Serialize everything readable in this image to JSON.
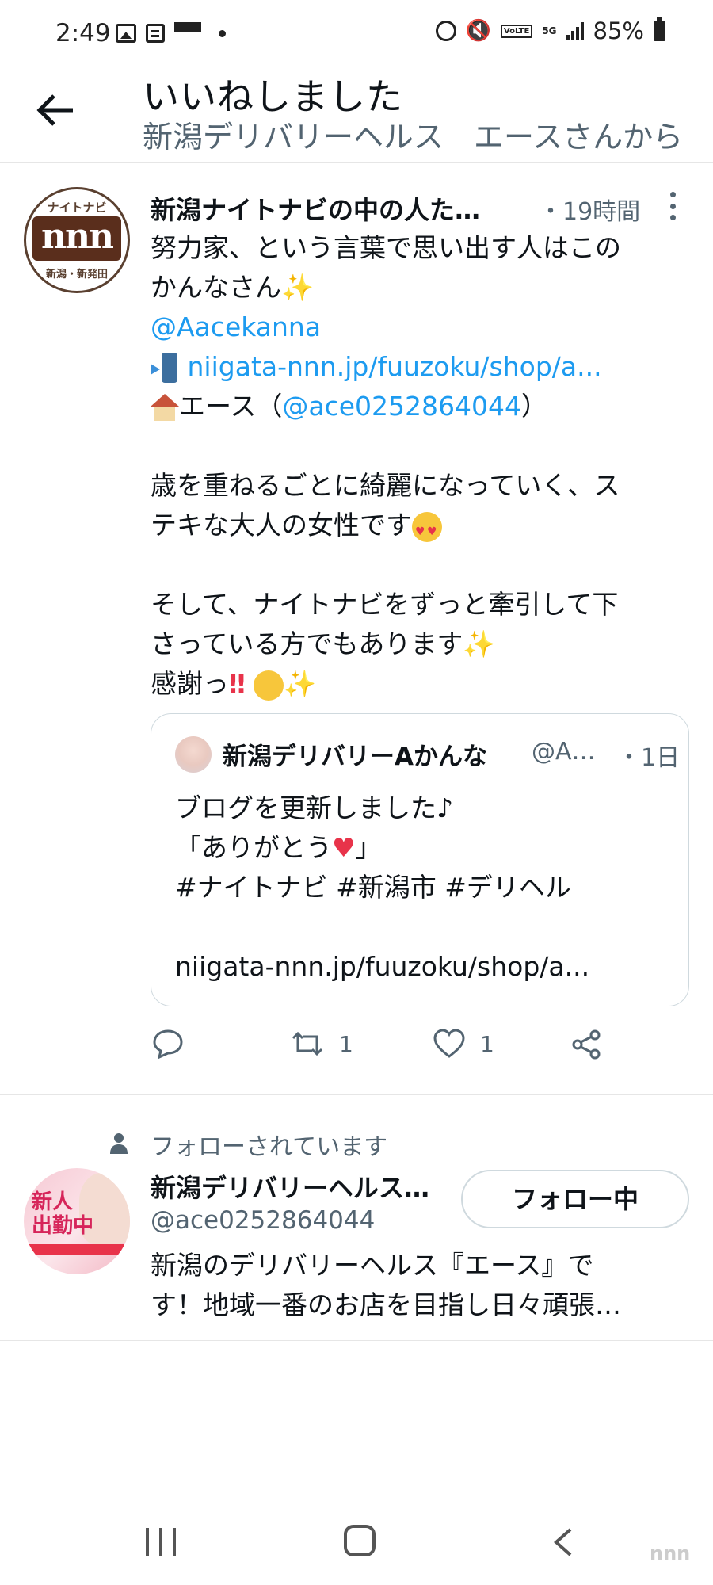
{
  "status_bar": {
    "time": "2:49",
    "battery": "85%",
    "network": "5G"
  },
  "header": {
    "title": "いいねしました",
    "subtitle": "新潟デリバリーヘルス　エースさんから"
  },
  "tweet": {
    "author_name": "新潟ナイトナビの中の人た…",
    "time": "・19時間",
    "avatar_text_top": "ナイトナビ",
    "avatar_text_mid": "nnn",
    "avatar_text_bottom": "新潟・新発田",
    "lines": {
      "l1": "努力家、という言葉で思い出す人はこの",
      "l2a": "かんなさん",
      "l3": "@Aacekanna",
      "l4": "niigata-nnn.jp/fuuzoku/shop/a...",
      "l5a": "エース（",
      "l5b": "@ace0252864044",
      "l5c": "）",
      "l6": "歳を重ねるごとに綺麗になっていく、ス",
      "l7a": "テキな大人の女性です",
      "l8": "そして、ナイトナビをずっと牽引して下",
      "l9a": "さっている方でもあります",
      "l10a": "感謝っ"
    },
    "sparkle": "✨",
    "bangs": "‼",
    "quote": {
      "name": "新潟デリバリーAかんな",
      "handle": "@A…",
      "time": "・1日",
      "lines": {
        "l1": "ブログを更新しました♪",
        "l2a": "「ありがとう",
        "l2b": "♥",
        "l2c": "」",
        "l3": "#ナイトナビ #新潟市 #デリヘル",
        "l4": "niigata-nnn.jp/fuuzoku/shop/a..."
      }
    },
    "actions": {
      "reply_icon": "reply-icon",
      "retweet_count": "1",
      "like_count": "1",
      "share_icon": "share-icon"
    }
  },
  "follow_card": {
    "label": "フォローされています",
    "name": "新潟デリバリーヘルス…",
    "handle": "@ace0252864044",
    "button": "フォロー中",
    "avatar_text": "新人\n出勤中",
    "bio_l1": "新潟のデリバリーヘルス『エース』で",
    "bio_l2": "す！地域一番のお店を目指し日々頑張…"
  },
  "colors": {
    "link": "#1d9bf0",
    "secondary_text": "#536471",
    "primary_text": "#0f1419",
    "border": "#cfd9de"
  },
  "watermark": "nnn"
}
